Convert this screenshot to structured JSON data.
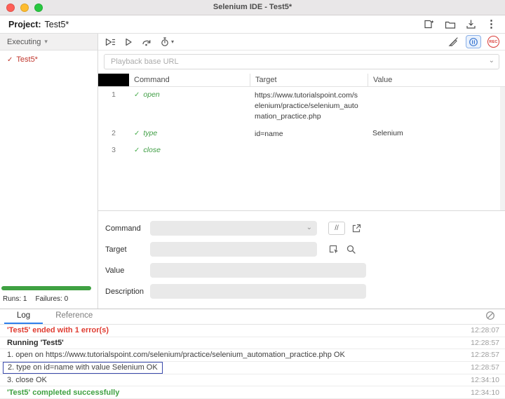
{
  "titlebar": {
    "title": "Selenium IDE - Test5*"
  },
  "project": {
    "label": "Project:",
    "name": "Test5*"
  },
  "icons": {
    "check": "✓",
    "caret_down": "⌄",
    "caret_small": "▾",
    "kebab": "⋮"
  },
  "toolbar": {
    "record_label": "REC"
  },
  "sidebar": {
    "dropdown_label": "Executing",
    "test_name": "Test5*",
    "runs": "Runs: 1",
    "failures": "Failures: 0"
  },
  "playback": {
    "placeholder": "Playback base URL"
  },
  "table": {
    "columns": [
      "Command",
      "Target",
      "Value"
    ],
    "rows": [
      {
        "num": "1",
        "command": "open",
        "target": "https://www.tutorialspoint.com/selenium/practice/selenium_automation_practice.php",
        "value": ""
      },
      {
        "num": "2",
        "command": "type",
        "target": "id=name",
        "value": "Selenium"
      },
      {
        "num": "3",
        "command": "close",
        "target": "",
        "value": ""
      }
    ]
  },
  "form": {
    "command_label": "Command",
    "target_label": "Target",
    "value_label": "Value",
    "description_label": "Description",
    "comment_button": "//"
  },
  "bottom": {
    "tabs": {
      "log": "Log",
      "reference": "Reference"
    },
    "log": [
      {
        "text": "'Test5' ended with 1 error(s)",
        "time": "12:28:07"
      },
      {
        "text": "Running 'Test5'",
        "time": "12:28:57"
      },
      {
        "text": "1.  open on https://www.tutorialspoint.com/selenium/practice/selenium_automation_practice.php OK",
        "time": "12:28:57"
      },
      {
        "text": "2.  type on id=name with value Selenium OK",
        "time": "12:28:57"
      },
      {
        "text": "3.  close OK",
        "time": "12:34:10"
      },
      {
        "text": "'Test5' completed successfully",
        "time": "12:34:10"
      }
    ]
  }
}
